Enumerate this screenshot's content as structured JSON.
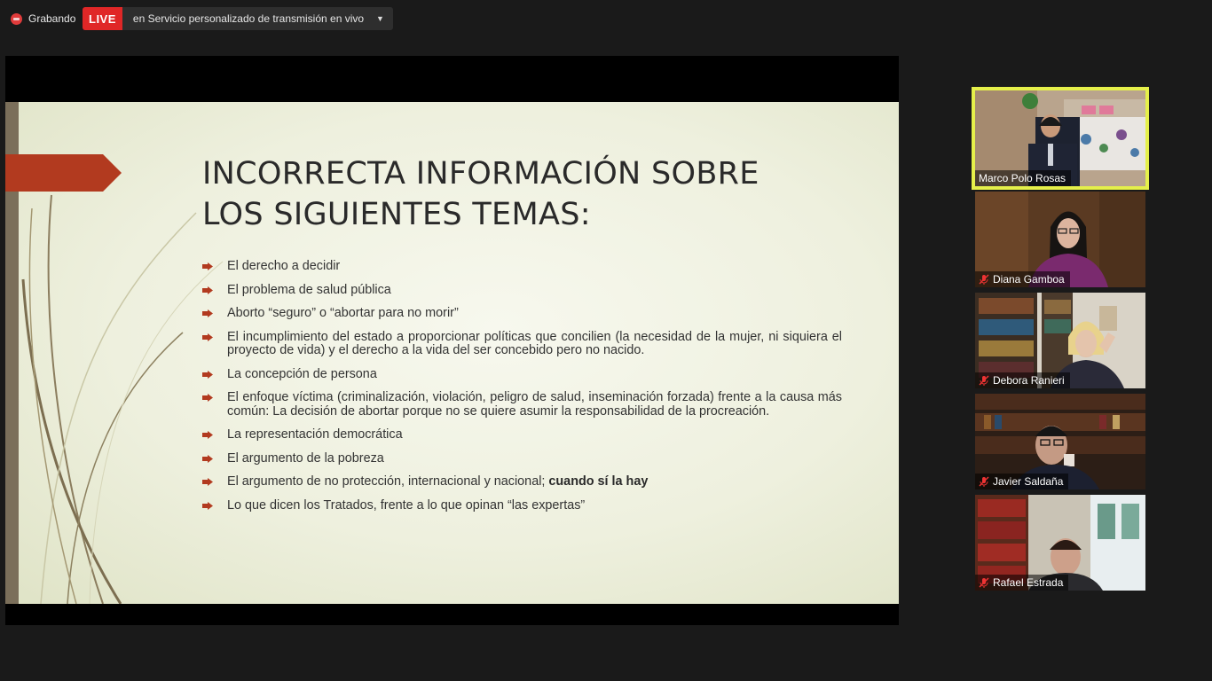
{
  "topbar": {
    "recording_label": "Grabando",
    "live_label": "LIVE",
    "live_service": "en Servicio personalizado de transmisión en vivo"
  },
  "slide": {
    "title": "INCORRECTA INFORMACIÓN SOBRE\nLOS SIGUIENTES TEMAS:",
    "bullets": [
      "El derecho a decidir",
      "El problema  de salud pública",
      "Aborto “seguro” o “abortar para no morir”",
      "El incumplimiento del estado a proporcionar políticas que concilien (la necesidad de la mujer, ni siquiera el proyecto de vida) y el derecho a la vida del ser concebido pero no nacido.",
      "La concepción de persona",
      "El enfoque víctima (criminalización,  violación, peligro de salud, inseminación forzada) frente a la causa más común: La decisión de abortar porque no se quiere asumir la responsabilidad de la procreación.",
      "La representación democrática",
      "El argumento de la pobreza",
      "El argumento de no protección, internacional y nacional; ",
      "Lo que dicen los Tratados, frente a lo que opinan “las expertas”"
    ],
    "bullet_bold_suffix": "cuando sí la hay",
    "accent_color": "#b23a1f"
  },
  "participants": [
    {
      "name": "Marco Polo Rosas",
      "muted": false,
      "active": true
    },
    {
      "name": "Diana Gamboa",
      "muted": true,
      "active": false
    },
    {
      "name": "Debora Ranieri",
      "muted": true,
      "active": false
    },
    {
      "name": "Javier Saldaña",
      "muted": true,
      "active": false
    },
    {
      "name": "Rafael Estrada",
      "muted": true,
      "active": false
    }
  ]
}
